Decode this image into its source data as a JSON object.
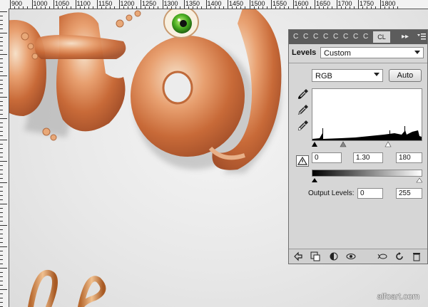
{
  "ruler": {
    "top_labels": [
      "900",
      "1000",
      "1050",
      "1100",
      "1150",
      "1200",
      "1250",
      "1300",
      "1350",
      "1400",
      "1450",
      "1500",
      "1550",
      "1600",
      "1650",
      "1700",
      "1750",
      "1800"
    ]
  },
  "panel": {
    "tab_chars": [
      "C",
      "C",
      "C",
      "C",
      "C",
      "C",
      "C",
      "C"
    ],
    "active_tab_label": "CL",
    "menu_arrows": "▸▸",
    "menu_icon": "menu-icon",
    "title": "Levels",
    "preset_value": "Custom",
    "channel_value": "RGB",
    "auto_label": "Auto",
    "input_black": "0",
    "input_gamma": "1.30",
    "input_white": "180",
    "output_label": "Output Levels:",
    "output_black": "0",
    "output_white": "255"
  },
  "colors": {
    "tab_bar": "#5c5c5c",
    "panel_bg": "#d6d6d6",
    "artwork_orange": "#d9763c",
    "eye_green": "#4caf22"
  },
  "watermark": "alfoart.com"
}
